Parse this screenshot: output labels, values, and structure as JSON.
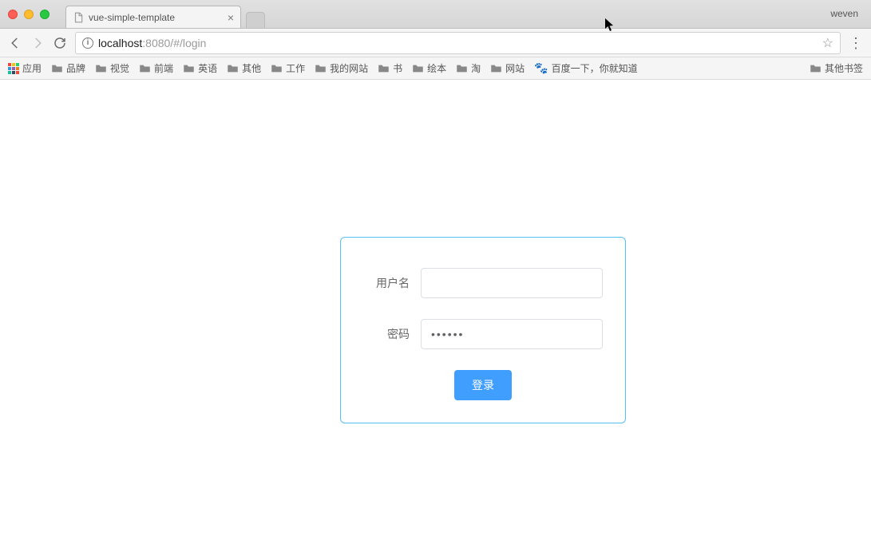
{
  "window": {
    "profile": "weven"
  },
  "tab": {
    "title": "vue-simple-template"
  },
  "address": {
    "host": "localhost",
    "port_and_path": ":8080/#/login"
  },
  "bookmarks": {
    "apps_label": "应用",
    "folders": [
      "品牌",
      "视觉",
      "前端",
      "英语",
      "其他",
      "工作",
      "我的网站",
      "书",
      "绘本",
      "淘",
      "网站"
    ],
    "baidu_label": "百度一下，你就知道",
    "other_label": "其他书签"
  },
  "login": {
    "username_label": "用户名",
    "username_value": "",
    "password_label": "密码",
    "password_value": "123456",
    "submit_label": "登录"
  },
  "colors": {
    "card_border": "#55c0f2",
    "primary": "#409eff"
  }
}
